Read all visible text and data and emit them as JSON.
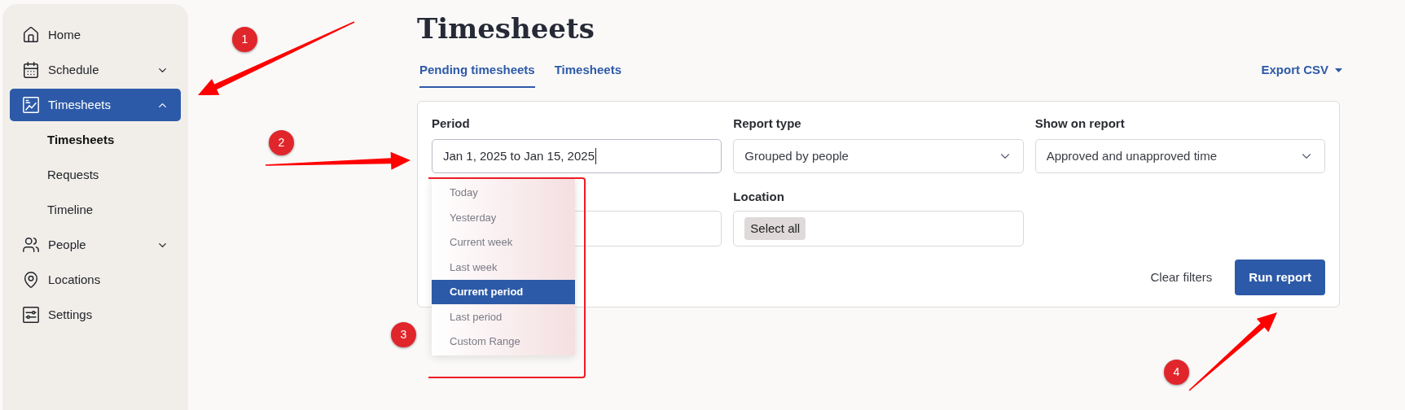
{
  "sidebar": {
    "items": [
      {
        "label": "Home",
        "selected": false
      },
      {
        "label": "Schedule",
        "selected": false,
        "expanded": false
      },
      {
        "label": "Timesheets",
        "selected": true,
        "expanded": true,
        "children": [
          {
            "label": "Timesheets",
            "selected": true
          },
          {
            "label": "Requests",
            "selected": false
          },
          {
            "label": "Timeline",
            "selected": false
          }
        ]
      },
      {
        "label": "People",
        "selected": false,
        "expanded": false
      },
      {
        "label": "Locations",
        "selected": false
      },
      {
        "label": "Settings",
        "selected": false
      }
    ]
  },
  "page_title": "Timesheets",
  "tabs": [
    {
      "label": "Pending timesheets",
      "selected": true
    },
    {
      "label": "Timesheets",
      "selected": false
    }
  ],
  "export_button": "Export CSV",
  "filters": {
    "period": {
      "label": "Period",
      "value": "Jan 1, 2025 to Jan 15, 2025",
      "options": [
        {
          "label": "Today",
          "selected": false
        },
        {
          "label": "Yesterday",
          "selected": false
        },
        {
          "label": "Current week",
          "selected": false
        },
        {
          "label": "Last week",
          "selected": false
        },
        {
          "label": "Current period",
          "selected": true
        },
        {
          "label": "Last period",
          "selected": false
        },
        {
          "label": "Custom Range",
          "selected": false
        }
      ]
    },
    "report_type": {
      "label": "Report type",
      "value": "Grouped by people"
    },
    "show_on_report": {
      "label": "Show on report",
      "value": "Approved and unapproved time"
    },
    "location": {
      "label": "Location",
      "chip": "Select all"
    }
  },
  "actions": {
    "clear": "Clear filters",
    "run": "Run report"
  },
  "annotations": [
    {
      "number": "1"
    },
    {
      "number": "2"
    },
    {
      "number": "3"
    },
    {
      "number": "4"
    }
  ]
}
